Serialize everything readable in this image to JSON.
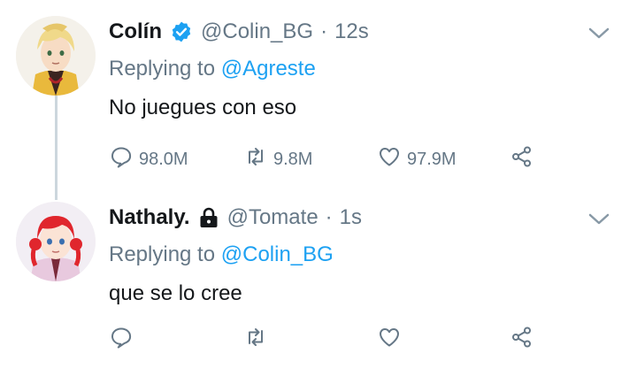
{
  "tweets": [
    {
      "name": "Colín",
      "handle": "@Colin_BG",
      "separator": "·",
      "time": "12s",
      "verified": true,
      "replying_prefix": "Replying to",
      "replying_to": "@Agreste",
      "text": "No juegues con eso",
      "reply_count": "98.0M",
      "retweet_count": "9.8M",
      "like_count": "97.9M"
    },
    {
      "name": "Nathaly.",
      "handle": "@Tomate",
      "separator": "·",
      "time": "1s",
      "locked": true,
      "replying_prefix": "Replying to",
      "replying_to": "@Colin_BG",
      "text": "que se lo cree",
      "reply_count": "",
      "retweet_count": "",
      "like_count": ""
    }
  ],
  "colors": {
    "accent": "#1da1f2",
    "muted": "#657786",
    "text": "#14171a",
    "thread": "#ccd6dd"
  },
  "icons": [
    "chevron-down-icon",
    "reply-icon",
    "retweet-icon",
    "like-icon",
    "share-icon",
    "verified-icon",
    "lock-icon"
  ]
}
